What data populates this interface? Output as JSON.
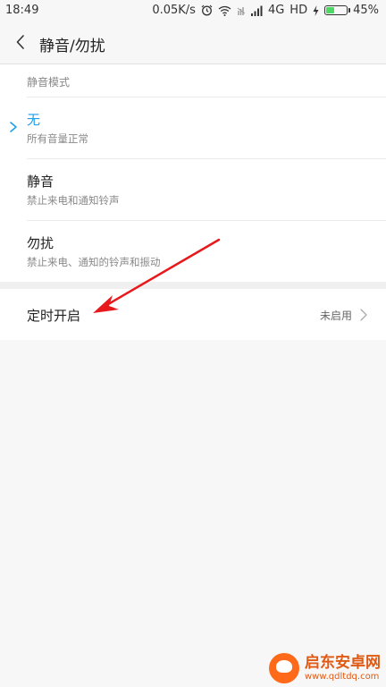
{
  "status_bar": {
    "time": "18:49",
    "network_speed": "0.05K/s",
    "network_type": "4G",
    "hd_label": "HD",
    "battery_text": "45%",
    "battery_level": 0.45,
    "battery_color": "#4cd964"
  },
  "header": {
    "title": "静音/勿扰",
    "back_icon": "chevron-left-icon"
  },
  "mode_section": {
    "header": "静音模式",
    "options": [
      {
        "title": "无",
        "description": "所有音量正常",
        "selected": true
      },
      {
        "title": "静音",
        "description": "禁止来电和通知铃声",
        "selected": false
      },
      {
        "title": "勿扰",
        "description": "禁止来电、通知的铃声和振动",
        "selected": false
      }
    ]
  },
  "schedule": {
    "label": "定时开启",
    "value": "未启用"
  },
  "watermark": {
    "title": "启东安卓网",
    "url": "www.qdltdq.com"
  },
  "colors": {
    "accent": "#1e9fe8",
    "annotation": "#e8191c",
    "watermark": "#e05a14"
  }
}
